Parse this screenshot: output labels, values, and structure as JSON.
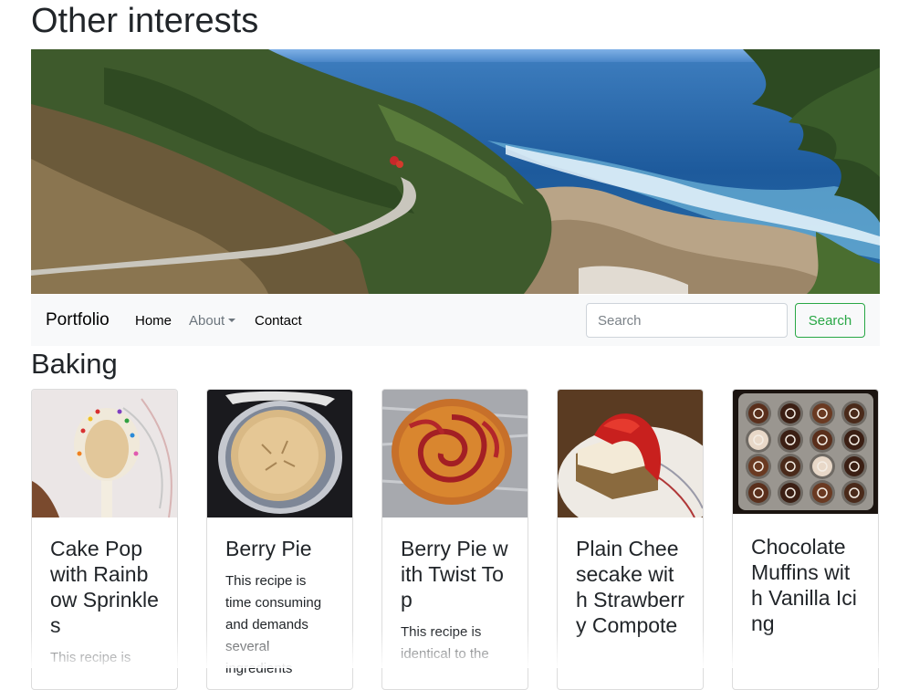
{
  "page": {
    "title": "Other interests",
    "section_title": "Baking"
  },
  "hero": {
    "image_description": "coastal cliffs with winding path and ocean"
  },
  "navbar": {
    "brand": "Portfolio",
    "links": [
      {
        "label": "Home"
      },
      {
        "label": "About"
      },
      {
        "label": "Contact"
      }
    ],
    "search": {
      "placeholder": "Search",
      "value": "",
      "button_label": "Search"
    },
    "colors": {
      "background": "#f8f9fa",
      "search_button": "#28a745"
    }
  },
  "cards": [
    {
      "title": "Cake Pop with Rainbow Sprinkles",
      "text": "This recipe is",
      "image": "cake-pop-photo"
    },
    {
      "title": "Berry Pie",
      "text": "This recipe is time consuming and demands several ingredients",
      "image": "berry-pie-photo"
    },
    {
      "title": "Berry Pie with Twist Top",
      "text": "This recipe is identical to the",
      "image": "twist-pie-photo"
    },
    {
      "title": "Plain Cheesecake with Strawberry Compote",
      "text": "",
      "image": "cheesecake-photo"
    },
    {
      "title": "Chocolate Muffins with Vanilla Icing",
      "text": "",
      "image": "chocolate-muffins-photo"
    }
  ]
}
